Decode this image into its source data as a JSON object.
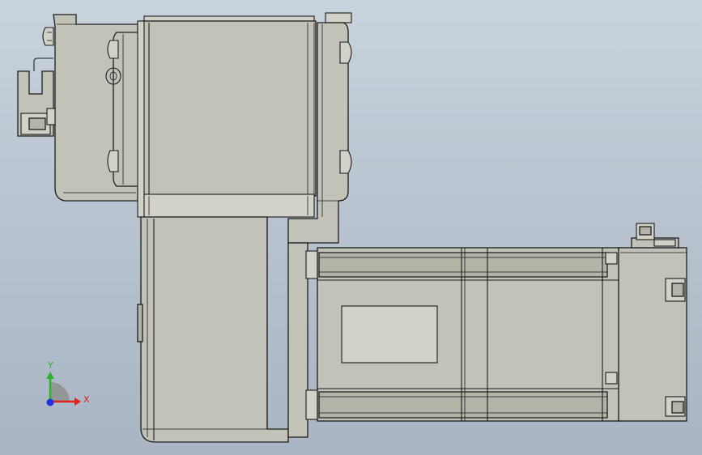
{
  "triad": {
    "x_label": "X",
    "y_label": "Y",
    "x_color": "#e0201c",
    "y_color": "#2ab52a",
    "z_color": "#2233dd"
  },
  "colors": {
    "background_top": "#c9d3dd",
    "background_bottom": "#a9b5c3",
    "part_fill": "#c2c2b8",
    "edge": "#1c1c1c"
  }
}
